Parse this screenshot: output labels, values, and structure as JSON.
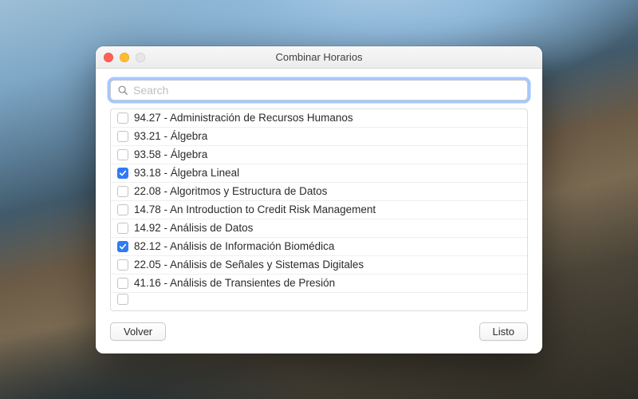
{
  "window": {
    "title": "Combinar Horarios"
  },
  "search": {
    "placeholder": "Search",
    "value": ""
  },
  "courses": [
    {
      "code": "94.27",
      "name": "Administración de Recursos Humanos",
      "checked": false
    },
    {
      "code": "93.21",
      "name": "Álgebra",
      "checked": false
    },
    {
      "code": "93.58",
      "name": "Álgebra",
      "checked": false
    },
    {
      "code": "93.18",
      "name": "Álgebra Lineal",
      "checked": true
    },
    {
      "code": "22.08",
      "name": "Algoritmos y Estructura de Datos",
      "checked": false
    },
    {
      "code": "14.78",
      "name": "An Introduction to Credit Risk Management",
      "checked": false
    },
    {
      "code": "14.92",
      "name": "Análisis de Datos",
      "checked": false
    },
    {
      "code": "82.12",
      "name": "Análisis de Información Biomédica",
      "checked": true
    },
    {
      "code": "22.05",
      "name": "Análisis de Señales y Sistemas Digitales",
      "checked": false
    },
    {
      "code": "41.16",
      "name": "Análisis de Transientes de Presión",
      "checked": false
    }
  ],
  "buttons": {
    "back": "Volver",
    "done": "Listo"
  },
  "colors": {
    "accent": "#2f7bf6",
    "focus_ring": "#5b9aff"
  }
}
